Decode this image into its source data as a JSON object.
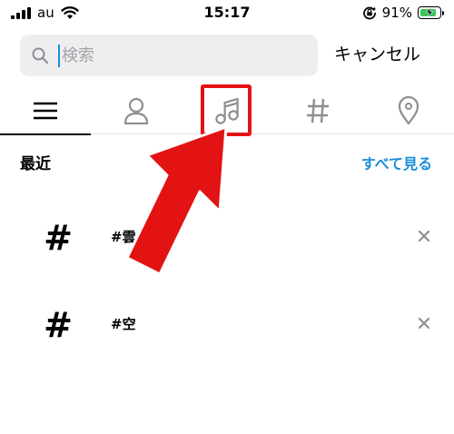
{
  "status_bar": {
    "carrier": "au",
    "time": "15:17",
    "battery_percent": "91%",
    "battery_level": 0.91,
    "icons": [
      "signal-icon",
      "wifi-icon",
      "orientation-lock-icon",
      "battery-icon"
    ]
  },
  "search": {
    "placeholder": "検索",
    "value": "",
    "cancel_label": "キャンセル"
  },
  "tabs": [
    {
      "name": "top",
      "icon": "menu-lines-icon",
      "selected": true
    },
    {
      "name": "accounts",
      "icon": "person-icon",
      "selected": false
    },
    {
      "name": "sounds",
      "icon": "music-note-icon",
      "selected": false
    },
    {
      "name": "hashtags",
      "icon": "hashtag-icon",
      "selected": false
    },
    {
      "name": "places",
      "icon": "location-pin-icon",
      "selected": false
    }
  ],
  "recent": {
    "title": "最近",
    "see_all": "すべて見る",
    "items": [
      {
        "symbol": "#",
        "label": "#雲"
      },
      {
        "symbol": "#",
        "label": "#空"
      }
    ]
  },
  "colors": {
    "accent": "#1a8fd9",
    "annotation_red": "#e31313",
    "search_bg": "#eeeef0",
    "battery_green": "#37c75a"
  }
}
